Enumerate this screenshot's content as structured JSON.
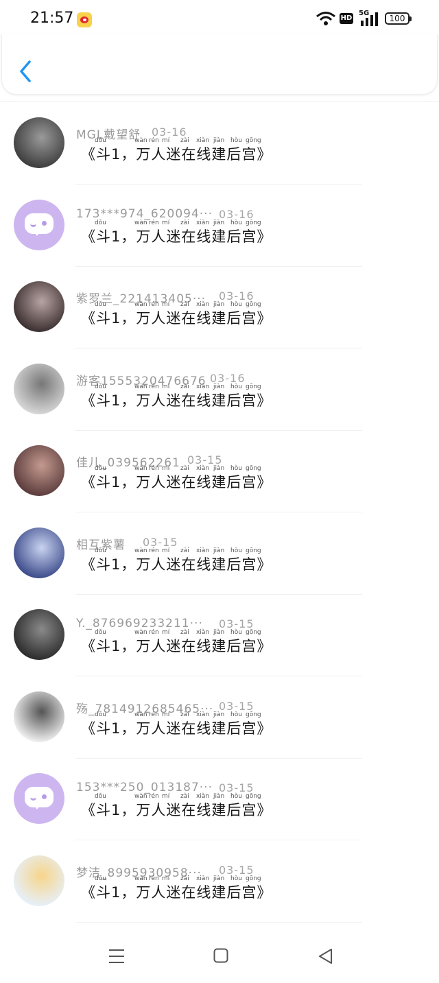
{
  "status_bar": {
    "time": "21:57",
    "network": "5G",
    "battery": "100",
    "hd": "HD"
  },
  "header": {
    "back_icon": "chevron-left-icon",
    "accent_color": "#2196f3"
  },
  "list": {
    "title_text": "《斗1，万人迷在线建后宫》",
    "items": [
      {
        "name": "MGL戴望舒",
        "date": "03-16",
        "avatar": "photo"
      },
      {
        "name": "173***974_620094···",
        "date": "03-16",
        "avatar": "default"
      },
      {
        "name": "紫罗兰_221413405···",
        "date": "03-16",
        "avatar": "photo"
      },
      {
        "name": "游客1555320476676",
        "date": "03-16",
        "avatar": "photo"
      },
      {
        "name": "佳儿_039562261",
        "date": "03-15",
        "avatar": "photo"
      },
      {
        "name": "相互紫薯",
        "date": "03-15",
        "avatar": "photo"
      },
      {
        "name": "Y._876969233211···",
        "date": "03-15",
        "avatar": "photo"
      },
      {
        "name": "殇_7814912685465···",
        "date": "03-15",
        "avatar": "photo"
      },
      {
        "name": "153***250_013187···",
        "date": "03-15",
        "avatar": "default"
      },
      {
        "name": "梦洁_8995930958···",
        "date": "03-15",
        "avatar": "photo"
      }
    ]
  },
  "nav": {
    "menu_icon": "menu-icon",
    "home_icon": "home-icon",
    "back_icon": "back-triangle-icon"
  }
}
